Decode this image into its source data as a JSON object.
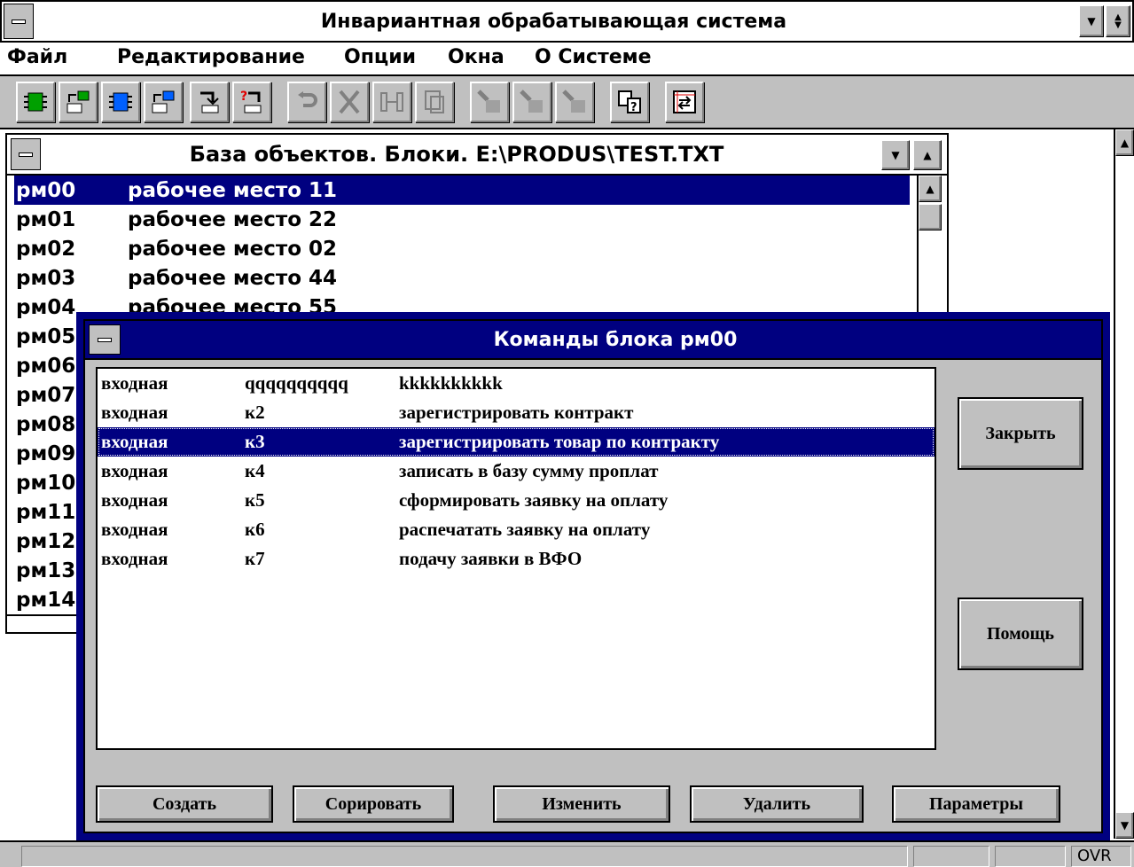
{
  "app": {
    "title": "Инвариантная обрабатывающая система"
  },
  "menu": {
    "file": "Файл",
    "edit": "Редактирование",
    "options": "Опции",
    "windows": "Окна",
    "about": "О Системе"
  },
  "toolbar": {
    "icons": [
      "new-block-icon",
      "import-block-icon",
      "new-object-icon",
      "import-object-icon",
      "link-icon",
      "link-help-icon",
      "undo-icon",
      "cut-icon",
      "paste-link-icon",
      "copy-icon",
      "search-icon",
      "search-next-icon",
      "search-prev-icon",
      "context-help-icon",
      "refresh-icon"
    ]
  },
  "db_window": {
    "title": "База объектов. Блоки. E:\\PRODUS\\TEST.TXT",
    "rows": [
      {
        "code": "рм00",
        "name": "рабочее место 11"
      },
      {
        "code": "рм01",
        "name": "рабочее место 22"
      },
      {
        "code": "рм02",
        "name": "рабочее место 02"
      },
      {
        "code": "рм03",
        "name": "рабочее место 44"
      },
      {
        "code": "рм04",
        "name": "рабочее место 55"
      },
      {
        "code": "рм05",
        "name": ""
      },
      {
        "code": "рм06",
        "name": ""
      },
      {
        "code": "рм07",
        "name": ""
      },
      {
        "code": "рм08",
        "name": ""
      },
      {
        "code": "рм09",
        "name": ""
      },
      {
        "code": "рм10",
        "name": ""
      },
      {
        "code": "рм11",
        "name": ""
      },
      {
        "code": "рм12",
        "name": ""
      },
      {
        "code": "рм13",
        "name": ""
      },
      {
        "code": "рм14",
        "name": ""
      }
    ]
  },
  "dialog": {
    "title": "Команды блока рм00",
    "commands": [
      {
        "type": "входная",
        "id": "qqqqqqqqqq",
        "desc": "kkkkkkkkkk"
      },
      {
        "type": "входная",
        "id": "к2",
        "desc": "зарегистрировать контракт"
      },
      {
        "type": "входная",
        "id": "к3",
        "desc": "зарегистрировать товар по контракту"
      },
      {
        "type": "входная",
        "id": "к4",
        "desc": "записать в базу сумму проплат"
      },
      {
        "type": "входная",
        "id": "к5",
        "desc": "сформировать заявку на оплату"
      },
      {
        "type": "входная",
        "id": "к6",
        "desc": "распечатать заявку на оплату"
      },
      {
        "type": "входная",
        "id": "к7",
        "desc": "подачу заявки в ВФО"
      }
    ],
    "buttons": {
      "close": "Закрыть",
      "help": "Помощь",
      "create": "Создать",
      "copy": "Copировать",
      "edit": "Изменить",
      "delete": "Удалить",
      "params": "Параметры"
    }
  },
  "status": {
    "ovr": "OVR"
  }
}
